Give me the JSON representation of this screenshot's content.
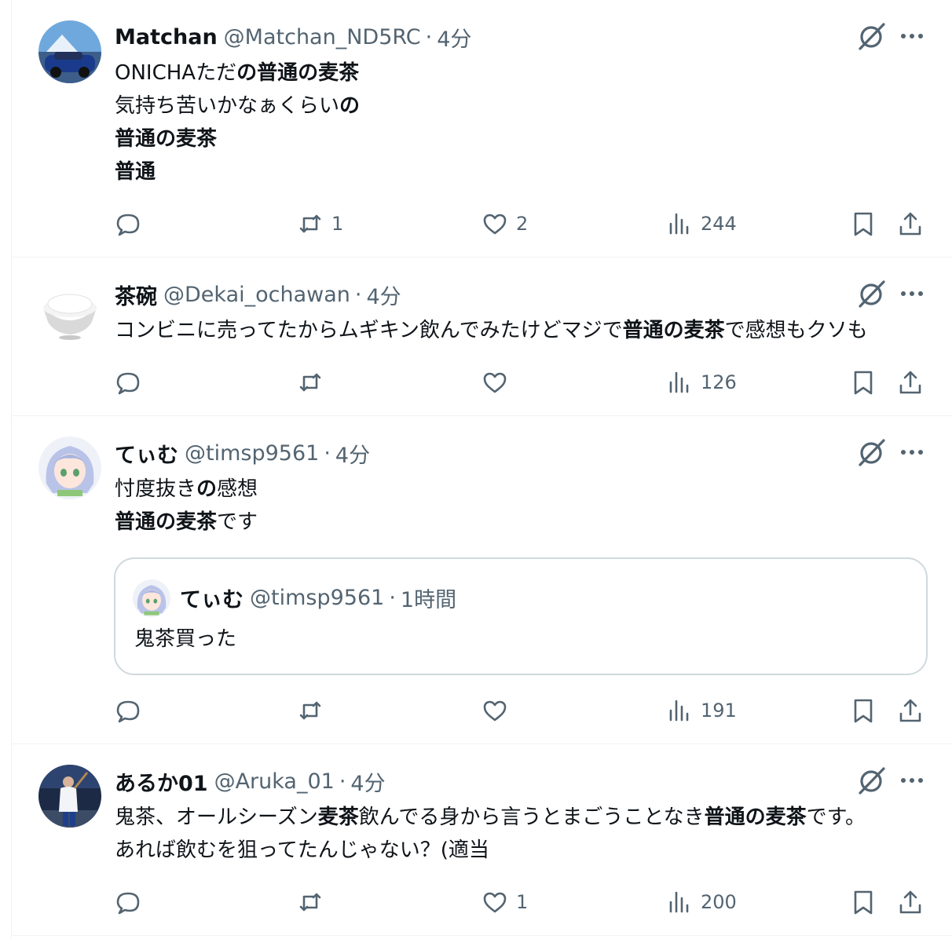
{
  "tweets": [
    {
      "name": "Matchan",
      "handle": "@Matchan_ND5RC",
      "time": "4分",
      "lines": [
        [
          {
            "t": "ONICHAただ",
            "b": false
          },
          {
            "t": "の普通の麦茶",
            "b": true
          }
        ],
        [
          {
            "t": "気持ち苦いかなぁくらい",
            "b": false
          },
          {
            "t": "の",
            "b": true
          }
        ],
        [
          {
            "t": "普通の麦茶",
            "b": true
          }
        ],
        [
          {
            "t": "普通",
            "b": true
          }
        ]
      ],
      "stats": {
        "replies": "",
        "retweets": "1",
        "likes": "2",
        "views": "244"
      }
    },
    {
      "name": "茶碗",
      "handle": "@Dekai_ochawan",
      "time": "4分",
      "lines": [
        [
          {
            "t": "コンビニに売ってたからムギキン飲んでみたけどマジで",
            "b": false
          },
          {
            "t": "普通の麦茶",
            "b": true
          },
          {
            "t": "で感想もクソも",
            "b": false
          }
        ]
      ],
      "stats": {
        "replies": "",
        "retweets": "",
        "likes": "",
        "views": "126"
      }
    },
    {
      "name": "てぃむ",
      "handle": "@timsp9561",
      "time": "4分",
      "lines": [
        [
          {
            "t": "忖度抜き",
            "b": false
          },
          {
            "t": "の",
            "b": true
          },
          {
            "t": "感想",
            "b": false
          }
        ],
        [
          {
            "t": "普通の麦茶",
            "b": true
          },
          {
            "t": "です",
            "b": false
          }
        ]
      ],
      "quote": {
        "name": "てぃむ",
        "handle": "@timsp9561",
        "time": "1時間",
        "text": "鬼茶買った"
      },
      "stats": {
        "replies": "",
        "retweets": "",
        "likes": "",
        "views": "191"
      }
    },
    {
      "name": "あるか01",
      "handle": "@Aruka_01",
      "time": "4分",
      "lines": [
        [
          {
            "t": "鬼茶、オールシーズン",
            "b": false
          },
          {
            "t": "麦茶",
            "b": true
          },
          {
            "t": "飲んでる身から言うとまごうことなき",
            "b": false
          },
          {
            "t": "普通の麦茶",
            "b": true
          },
          {
            "t": "です。",
            "b": false
          }
        ],
        [
          {
            "t": "あれば飲むを狙ってたんじゃない？(適当",
            "b": false
          }
        ]
      ],
      "stats": {
        "replies": "",
        "retweets": "",
        "likes": "1",
        "views": "200"
      }
    }
  ],
  "header_separator": "·",
  "icons": {
    "reply": "reply-icon",
    "retweet": "retweet-icon",
    "like": "heart-icon",
    "views": "views-icon",
    "bookmark": "bookmark-icon",
    "share": "share-icon",
    "grok": "grok-icon",
    "more": "more-icon"
  },
  "colors": {
    "text": "#0f1419",
    "secondary": "#536471",
    "border": "#eff3f4",
    "quote_border": "#cfd9de"
  }
}
